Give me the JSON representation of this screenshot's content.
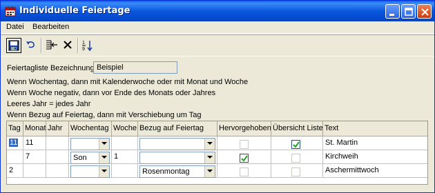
{
  "window": {
    "title": "Individuelle Feiertage"
  },
  "menu": {
    "items": [
      "Datei",
      "Bearbeiten"
    ]
  },
  "form": {
    "name_label": "Feiertagliste Bezeichnung",
    "name_value": "Beispiel",
    "help_lines": [
      "Wenn Wochentag, dann mit Kalenderwoche oder mit Monat und Woche",
      "Wenn Woche negativ, dann vor Ende des Monats oder Jahres",
      "Leeres Jahr = jedes Jahr",
      "Wenn Bezug auf Feiertag, dann mit Verschiebung um Tag"
    ]
  },
  "table": {
    "columns": [
      "Tag",
      "Monat",
      "Jahr",
      "Wochentag",
      "Woche",
      "Bezug auf Feiertag",
      "Hervorgehoben",
      "Übersicht Liste",
      "Text"
    ],
    "rows": [
      {
        "tag": "11",
        "monat": "11",
        "jahr": "",
        "wochentag": "",
        "woche": "",
        "bezug": "",
        "hervorgehoben": false,
        "uebersicht": true,
        "text": "St. Martin"
      },
      {
        "tag": "",
        "monat": "7",
        "jahr": "",
        "wochentag": "Son",
        "woche": "1",
        "bezug": "",
        "hervorgehoben": true,
        "uebersicht": false,
        "text": "Kirchweih"
      },
      {
        "tag": "2",
        "monat": "",
        "jahr": "",
        "wochentag": "",
        "woche": "",
        "bezug": "Rosenmontag",
        "hervorgehoben": false,
        "uebersicht": false,
        "text": "Aschermittwoch"
      }
    ]
  },
  "icons": [
    "app-icon",
    "minimize-icon",
    "maximize-icon",
    "close-icon",
    "save-icon",
    "undo-icon",
    "insert-row-icon",
    "delete-icon",
    "sort-icon"
  ]
}
